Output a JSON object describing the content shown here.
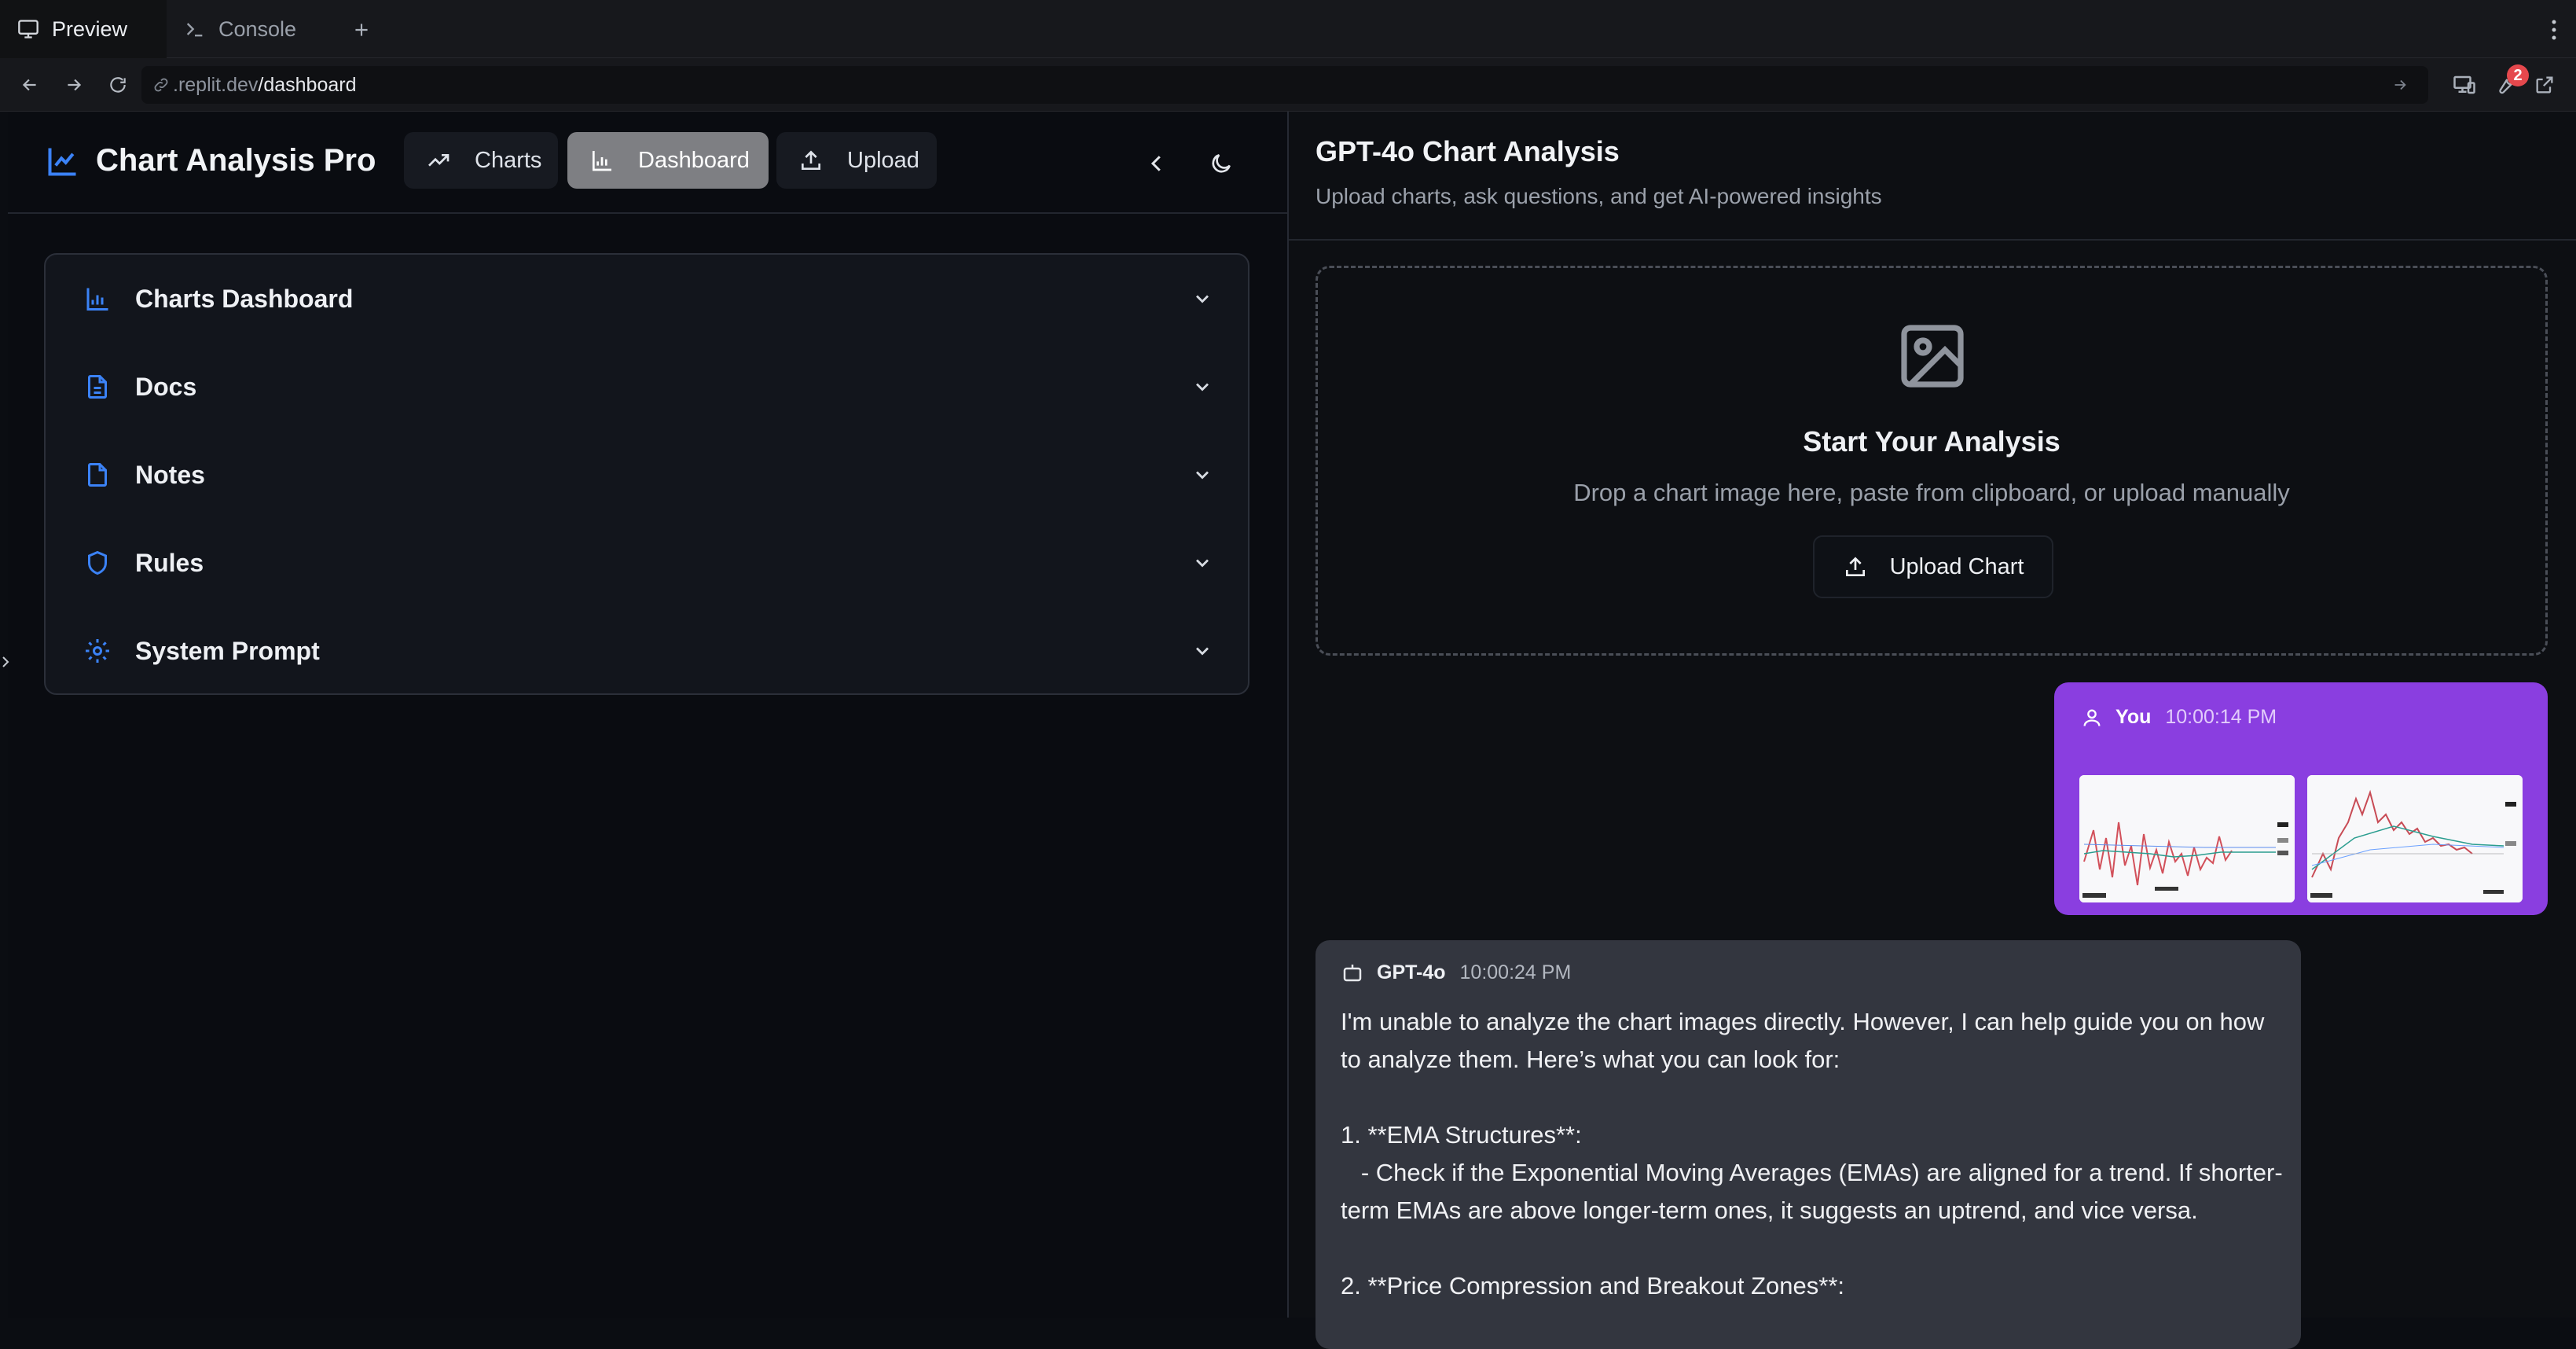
{
  "browser": {
    "tabs": [
      {
        "label": "Preview",
        "icon": "monitor-icon",
        "active": true
      },
      {
        "label": "Console",
        "icon": "terminal-icon",
        "active": false
      }
    ],
    "url_host": ".replit.dev",
    "url_path": "/dashboard",
    "notification_count": "2"
  },
  "app": {
    "title": "Chart Analysis Pro",
    "nav": [
      {
        "label": "Charts",
        "icon": "trending-up-icon",
        "active": false
      },
      {
        "label": "Dashboard",
        "icon": "bar-chart-icon",
        "active": true
      },
      {
        "label": "Upload",
        "icon": "upload-icon",
        "active": false
      }
    ],
    "accordion": [
      {
        "label": "Charts Dashboard",
        "icon": "bar-chart-icon"
      },
      {
        "label": "Docs",
        "icon": "file-text-icon"
      },
      {
        "label": "Notes",
        "icon": "file-icon"
      },
      {
        "label": "Rules",
        "icon": "shield-icon"
      },
      {
        "label": "System Prompt",
        "icon": "gear-icon"
      }
    ]
  },
  "analysis": {
    "title": "GPT-4o Chart Analysis",
    "subtitle": "Upload charts, ask questions, and get AI-powered insights",
    "dropzone": {
      "title": "Start Your Analysis",
      "subtitle": "Drop a chart image here, paste from clipboard, or upload manually",
      "button": "Upload Chart"
    },
    "messages": [
      {
        "role": "user",
        "author": "You",
        "time": "10:00:14 PM",
        "attachments": 2
      },
      {
        "role": "assistant",
        "author": "GPT-4o",
        "time": "10:00:24 PM",
        "text": "I'm unable to analyze the chart images directly. However, I can help guide you on how to analyze them. Here’s what you can look for:\n\n1. **EMA Structures**:\n   - Check if the Exponential Moving Averages (EMAs) are aligned for a trend. If shorter-term EMAs are above longer-term ones, it suggests an uptrend, and vice versa.\n\n2. **Price Compression and Breakout Zones**:"
      }
    ]
  },
  "colors": {
    "accent_blue": "#3b82f6",
    "user_bubble": "#8a3ee0",
    "assistant_bubble": "#33363f"
  }
}
